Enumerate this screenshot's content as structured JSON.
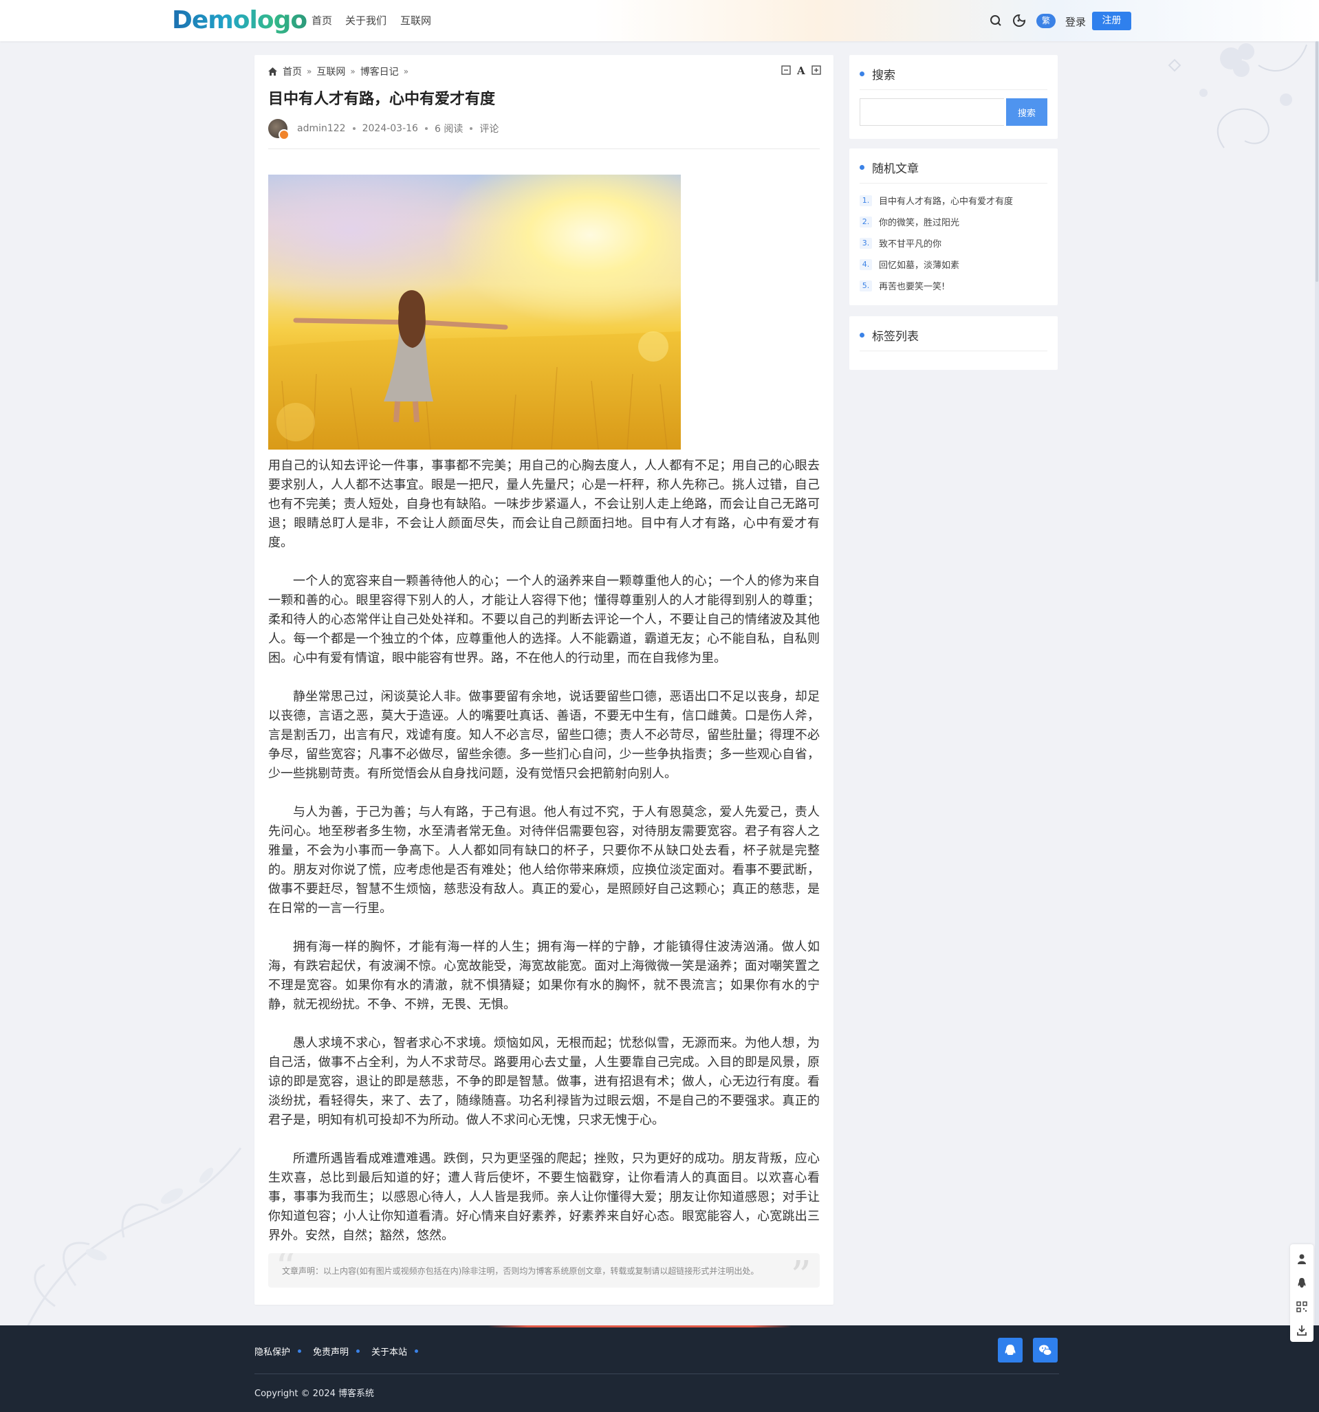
{
  "header": {
    "logo": "Demologo",
    "nav": [
      "首页",
      "关于我们",
      "互联网"
    ],
    "lang_badge": "繁",
    "login": "登录",
    "register": "注册",
    "icons": [
      "search-icon",
      "theme-toggle-icon"
    ]
  },
  "article": {
    "breadcrumb": [
      "首页",
      "互联网",
      "博客日记"
    ],
    "tools": [
      "font-smaller-icon",
      "font-size-icon",
      "font-larger-icon"
    ],
    "title": "目中有人才有路，心中有爱才有度",
    "meta": {
      "author": "admin122",
      "date": "2024-03-16",
      "views": "6 阅读",
      "comments": "评论"
    },
    "paragraphs": [
      "用自己的认知去评论一件事，事事都不完美；用自己的心胸去度人，人人都有不足；用自己的心眼去要求别人，人人都不达事宜。眼是一把尺，量人先量尺；心是一杆秤，称人先称己。挑人过错，自己也有不完美；责人短处，自身也有缺陷。一味步步紧逼人，不会让别人走上绝路，而会让自己无路可退；眼睛总盯人是非，不会让人颜面尽失，而会让自己颜面扫地。目中有人才有路，心中有爱才有度。",
      "一个人的宽容来自一颗善待他人的心；一个人的涵养来自一颗尊重他人的心；一个人的修为来自一颗和善的心。眼里容得下别人的人，才能让人容得下他；懂得尊重别人的人才能得到别人的尊重；柔和待人的心态常伴让自己处处祥和。不要以自己的判断去评论一个人，不要让自己的情绪波及其他人。每一个都是一个独立的个体，应尊重他人的选择。人不能霸道，霸道无友；心不能自私，自私则困。心中有爱有情谊，眼中能容有世界。路，不在他人的行动里，而在自我修为里。",
      "静坐常思己过，闲谈莫论人非。做事要留有余地，说话要留些口德，恶语出口不足以丧身，却足以丧德，言语之恶，莫大于造诬。人的嘴要吐真话、善语，不要无中生有，信口雌黄。口是伤人斧，言是割舌刀，出言有尺，戏谑有度。知人不必言尽，留些口德；责人不必苛尽，留些肚量；得理不必争尽，留些宽容；凡事不必做尽，留些余德。多一些扪心自问，少一些争执指责；多一些观心自省，少一些挑剔苛责。有所觉悟会从自身找问题，没有觉悟只会把箭射向别人。",
      "与人为善，于己为善；与人有路，于己有退。他人有过不究，于人有恩莫念，爱人先爱己，责人先问心。地至秽者多生物，水至清者常无鱼。对待伴侣需要包容，对待朋友需要宽容。君子有容人之雅量，不会为小事而一争高下。人人都如同有缺口的杯子，只要你不从缺口处去看，杯子就是完整的。朋友对你说了慌，应考虑他是否有难处；他人给你带来麻烦，应换位淡定面对。看事不要武断，做事不要赶尽，智慧不生烦恼，慈悲没有敌人。真正的爱心，是照顾好自己这颗心；真正的慈悲，是在日常的一言一行里。",
      "拥有海一样的胸怀，才能有海一样的人生；拥有海一样的宁静，才能镇得住波涛汹涌。做人如海，有跌宕起伏，有波澜不惊。心宽故能受，海宽故能宽。面对上海微微一笑是涵养；面对嘲笑置之不理是宽容。如果你有水的清澈，就不惧猜疑；如果你有水的胸怀，就不畏流言；如果你有水的宁静，就无视纷扰。不争、不辨，无畏、无惧。",
      "愚人求境不求心，智者求心不求境。烦恼如风，无根而起；忧愁似雪，无源而来。为他人想，为自己活，做事不占全利，为人不求苛尽。路要用心去丈量，人生要靠自己完成。入目的即是风景，原谅的即是宽容，退让的即是慈悲，不争的即是智慧。做事，进有招退有术；做人，心无边行有度。看淡纷扰，看轻得失，来了、去了，随缘随喜。功名利禄皆为过眼云烟，不是自己的不要强求。真正的君子是，明知有机可投却不为所动。做人不求问心无愧，只求无愧于心。",
      "所遭所遇皆看成难遭难遇。跌倒，只为更坚强的爬起；挫败，只为更好的成功。朋友背叛，应心生欢喜，总比到最后知道的好；遭人背后使坏，不要生恼戳穿，让你看清人的真面目。以欢喜心看事，事事为我而生；以感恩心待人，人人皆是我师。亲人让你懂得大爱；朋友让你知道感恩；对手让你知道包容；小人让你知道看清。好心情来自好素养，好素养来自好心态。眼宽能容人，心宽跳出三界外。安然，自然；豁然，悠然。"
    ],
    "statement": "文章声明：以上内容(如有图片或视频亦包括在内)除非注明，否则均为博客系统原创文章，转载或复制请以超链接形式并注明出处。"
  },
  "sidebar": {
    "search": {
      "title": "搜索",
      "placeholder": "",
      "button": "搜索"
    },
    "random": {
      "title": "随机文章",
      "items": [
        {
          "num": "1.",
          "text": "目中有人才有路，心中有爱才有度"
        },
        {
          "num": "2.",
          "text": "你的微笑，胜过阳光"
        },
        {
          "num": "3.",
          "text": "致不甘平凡的你"
        },
        {
          "num": "4.",
          "text": "回忆如墓，淡薄如素"
        },
        {
          "num": "5.",
          "text": "再苦也要笑一笑!"
        }
      ]
    },
    "tags": {
      "title": "标签列表"
    }
  },
  "footer": {
    "links": [
      "隐私保护",
      "免责声明",
      "关于本站"
    ],
    "icons": [
      "qq-icon",
      "wechat-icon"
    ],
    "copyright": "Copyright © 2024 博客系统"
  },
  "float_toolbar": [
    "user-icon",
    "qq-icon",
    "qrcode-icon",
    "download-icon"
  ],
  "colors": {
    "accent": "#2f80ed",
    "footer_bg": "#1e2734",
    "page_bg": "#f1f2f6"
  }
}
